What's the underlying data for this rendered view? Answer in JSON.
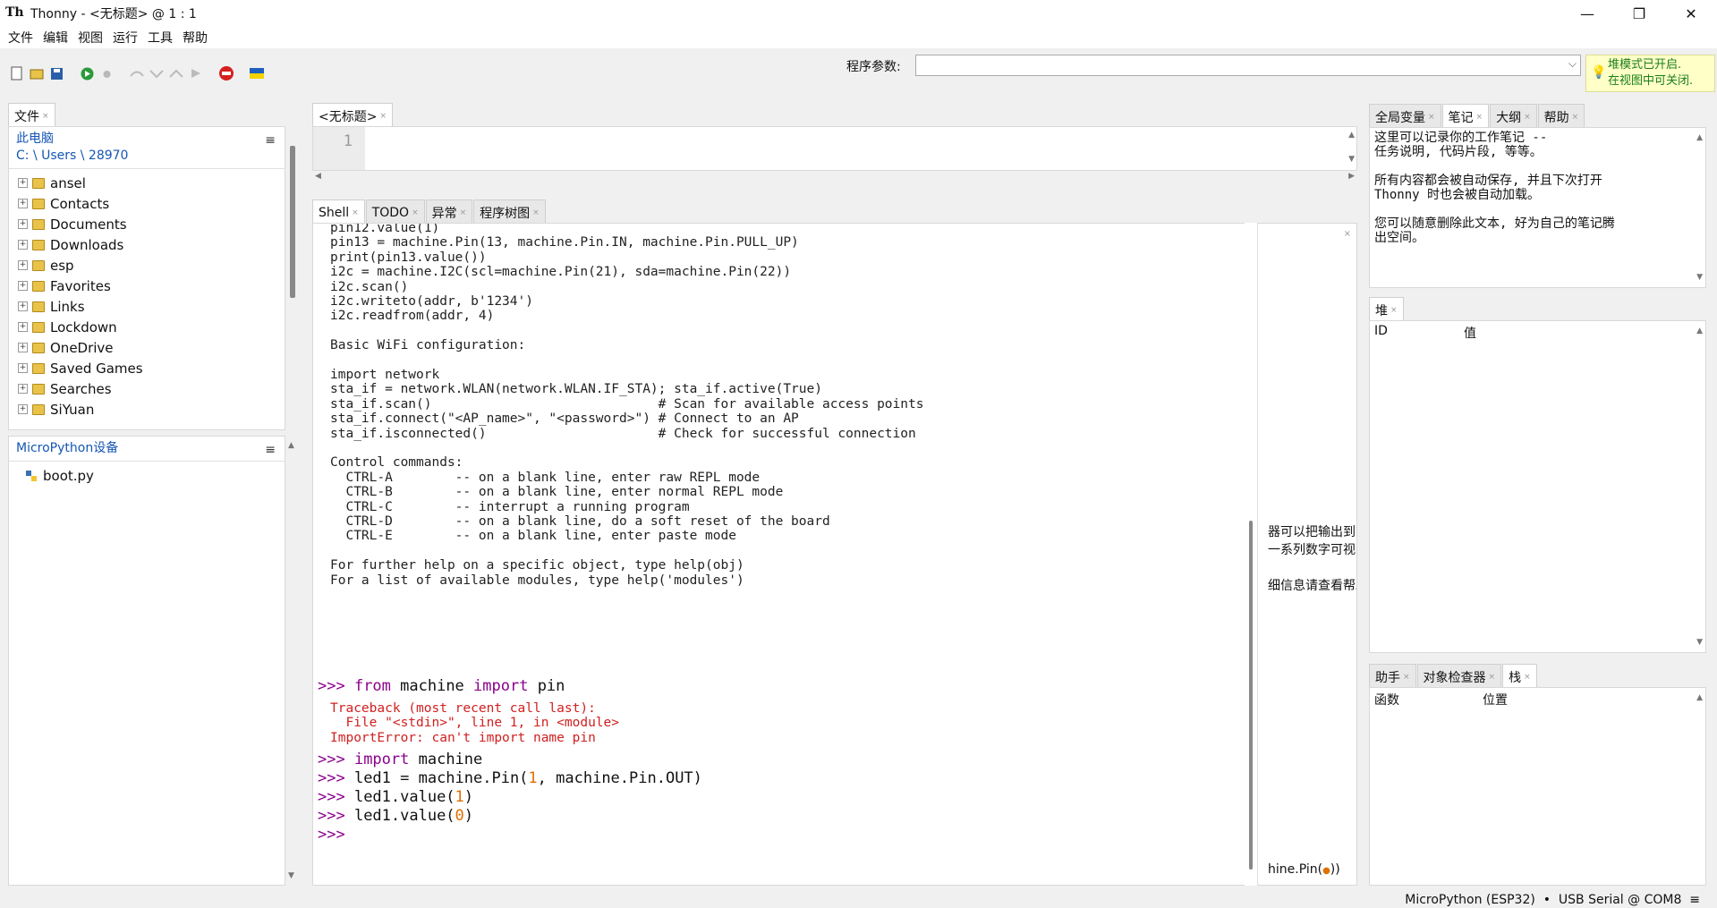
{
  "window": {
    "title": "Thonny  -  <无标题>  @  1 : 1",
    "minimize": "—",
    "maximize": "❐",
    "close": "✕"
  },
  "menu": [
    "文件",
    "编辑",
    "视图",
    "运行",
    "工具",
    "帮助"
  ],
  "toolbar": {
    "args_label": "程序参数:",
    "args_value": "",
    "heap_note_line1": "堆模式已开启.",
    "heap_note_line2": "在视图中可关闭."
  },
  "files": {
    "tab": "文件",
    "computer_label": "此电脑",
    "path": "C: \\ Users \\ 28970",
    "folders": [
      "ansel",
      "Contacts",
      "Documents",
      "Downloads",
      "esp",
      "Favorites",
      "Links",
      "Lockdown",
      "OneDrive",
      "Saved Games",
      "Searches",
      "SiYuan"
    ],
    "device_label": "MicroPython设备",
    "device_files": [
      "boot.py"
    ]
  },
  "editor": {
    "tab": "<无标题>",
    "line_number": "1"
  },
  "bottom_tabs": [
    "Shell",
    "TODO",
    "异常",
    "程序树图"
  ],
  "shell": {
    "output_lines": [
      "pin12.value(1)",
      "pin13 = machine.Pin(13, machine.Pin.IN, machine.Pin.PULL_UP)",
      "print(pin13.value())",
      "i2c = machine.I2C(scl=machine.Pin(21), sda=machine.Pin(22))",
      "i2c.scan()",
      "i2c.writeto(addr, b'1234')",
      "i2c.readfrom(addr, 4)",
      "",
      "Basic WiFi configuration:",
      "",
      "import network",
      "sta_if = network.WLAN(network.WLAN.IF_STA); sta_if.active(True)",
      "sta_if.scan()                             # Scan for available access points",
      "sta_if.connect(\"<AP_name>\", \"<password>\") # Connect to an AP",
      "sta_if.isconnected()                      # Check for successful connection",
      "",
      "Control commands:",
      "  CTRL-A        -- on a blank line, enter raw REPL mode",
      "  CTRL-B        -- on a blank line, enter normal REPL mode",
      "  CTRL-C        -- interrupt a running program",
      "  CTRL-D        -- on a blank line, do a soft reset of the board",
      "  CTRL-E        -- on a blank line, enter paste mode",
      "",
      "For further help on a specific object, type help(obj)",
      "For a list of available modules, type help('modules')"
    ],
    "prompt": ">>> ",
    "cmd1_kw1": "from",
    "cmd1_mid": " machine ",
    "cmd1_kw2": "import",
    "cmd1_end": " pin",
    "traceback": [
      "Traceback (most recent call last):",
      "  File \"<stdin>\", line 1, in <module>",
      "ImportError: can't import name pin"
    ],
    "cmd2_kw": "import",
    "cmd2_end": " machine",
    "cmd3_a": "led1 = machine.Pin(",
    "cmd3_n": "1",
    "cmd3_b": ", machine.Pin.OUT)",
    "cmd4_a": "led1.value(",
    "cmd4_n": "1",
    "cmd4_b": ")",
    "cmd5_a": "led1.value(",
    "cmd5_n": "0",
    "cmd5_b": ")"
  },
  "hint_panel": {
    "line1": "器可以把输出到",
    "line2": "一系列数字可视",
    "line3": "细信息请查看帮助",
    "line4_a": "hine.Pin(",
    "line4_dot": "●",
    "line4_b": "))"
  },
  "right_top_tabs": [
    "全局变量",
    "笔记",
    "大纲",
    "帮助"
  ],
  "notes_text": "这里可以记录你的工作笔记 --\n任务说明, 代码片段, 等等。\n\n所有内容都会被自动保存, 并且下次打开\nThonny 时也会被自动加载。\n\n您可以随意删除此文本, 好为自己的笔记腾\n出空间。",
  "heap": {
    "tab": "堆",
    "col_id": "ID",
    "col_value": "值"
  },
  "right_bottom_tabs": [
    "助手",
    "对象检查器",
    "栈"
  ],
  "stack": {
    "col_func": "函数",
    "col_loc": "位置"
  },
  "status": {
    "text": "MicroPython (ESP32)  •  USB Serial @ COM8  ≡"
  },
  "colors": {
    "prompt": "#8b008b",
    "error": "#d12020",
    "number": "#e07000",
    "link": "#1556b5"
  }
}
